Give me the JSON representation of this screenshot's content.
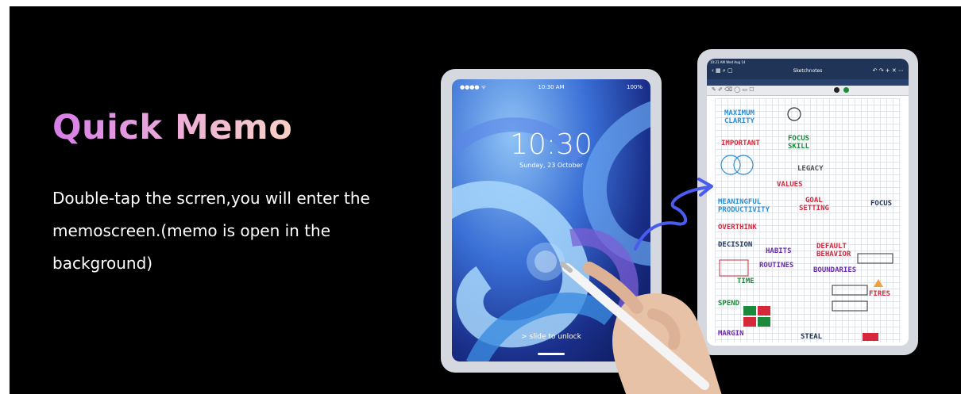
{
  "heading": "Quick Memo",
  "description": "Double-tap the scrren,you will enter the memoscreen.(memo is open in the background)",
  "left_tablet": {
    "status_time": "10:30 AM",
    "status_battery": "100%",
    "lock_time": "10:30",
    "lock_date": "Sunday, 23 October",
    "unlock_hint": "> slide to unlock"
  },
  "right_tablet": {
    "app_title": "Sketchnotes",
    "status_time": "10:21 AM Wed Aug 14",
    "note_words": [
      "MAXIMUM",
      "CLARITY",
      "IMPORTANT",
      "FOCUS",
      "SKILL",
      "LEGACY",
      "VALUES",
      "MEANINGFUL",
      "PRODUCTIVITY",
      "GOAL",
      "SETTING",
      "FOCUS",
      "OVERTHINK",
      "DECISION",
      "HABITS",
      "ROUTINES",
      "DEFAULT",
      "BEHAVIOR",
      "TIME",
      "BOUNDARIES",
      "FIRES",
      "SPEND",
      "MARGIN",
      "STEAL"
    ]
  },
  "colors": {
    "background": "#000000",
    "heading_start": "#d77de8",
    "heading_end": "#f7d2c4",
    "arrow": "#4a5bf0"
  }
}
